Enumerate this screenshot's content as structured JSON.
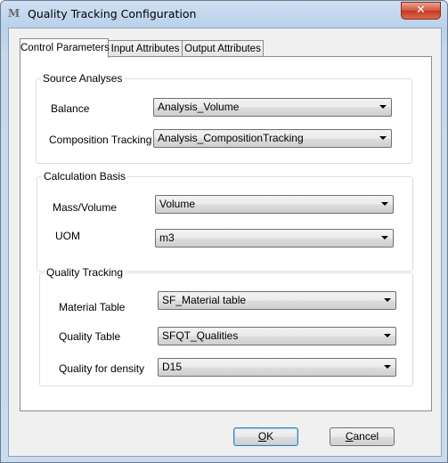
{
  "window": {
    "title": "Quality Tracking Configuration",
    "close_label": "✕"
  },
  "tabs": [
    {
      "label": "Control Parameters",
      "active": true
    },
    {
      "label": "Input Attributes",
      "active": false
    },
    {
      "label": "Output Attributes",
      "active": false
    }
  ],
  "source_analyses": {
    "title": "Source Analyses",
    "balance": {
      "label": "Balance",
      "value": "Analysis_Volume"
    },
    "composition_tracking": {
      "label": "Composition Tracking",
      "value": "Analysis_CompositionTracking"
    }
  },
  "calculation_basis": {
    "title": "Calculation Basis",
    "mass_volume": {
      "label": "Mass/Volume",
      "value": "Volume"
    },
    "uom": {
      "label": "UOM",
      "value": "m3"
    }
  },
  "quality_tracking": {
    "title": "Quality Tracking",
    "material_table": {
      "label": "Material Table",
      "value": "SF_Material table"
    },
    "quality_table": {
      "label": "Quality Table",
      "value": "SFQT_Qualities"
    },
    "quality_for_density": {
      "label": "Quality for density",
      "value": "D15"
    }
  },
  "buttons": {
    "ok": {
      "mnemonic": "O",
      "rest": "K"
    },
    "cancel": {
      "mnemonic": "C",
      "rest": "ancel"
    }
  },
  "icons": {
    "app": "app-logo-icon",
    "dropdown": "chevron-down-icon"
  }
}
